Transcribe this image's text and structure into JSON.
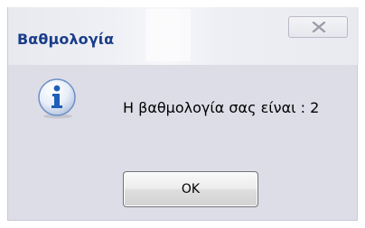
{
  "window": {
    "title": "Βαθμολογία",
    "close_icon": "close-icon"
  },
  "message": {
    "icon": "info-icon",
    "text": "Η βαθμολογία σας είναι : 2"
  },
  "buttons": {
    "ok_label": "OK"
  },
  "colors": {
    "title_text": "#1a3d8a",
    "dialog_bg": "#dcdde6",
    "icon_blue": "#1f5fb8"
  }
}
